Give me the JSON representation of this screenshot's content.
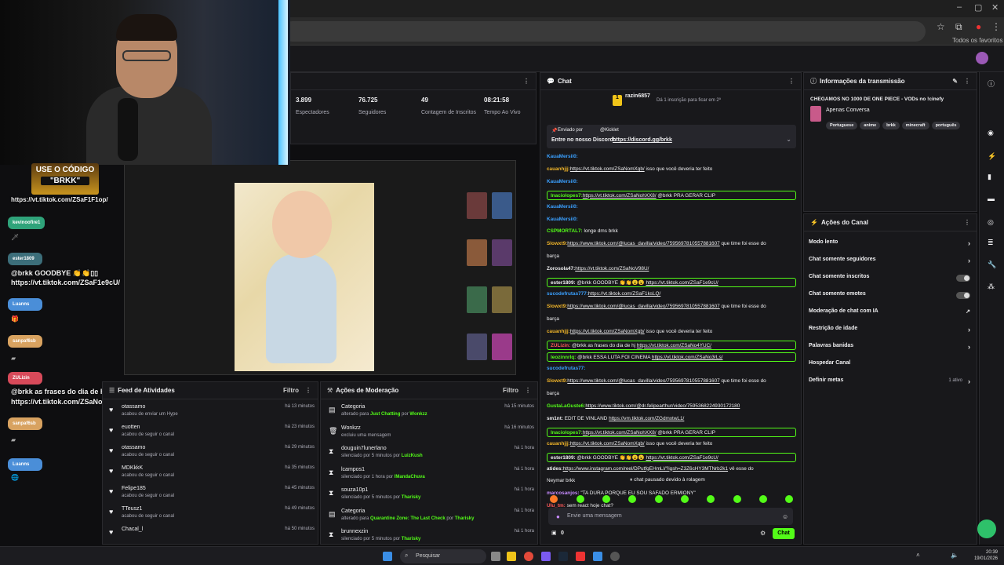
{
  "browser": {
    "favorites_label": "Todos os favoritos"
  },
  "stats": [
    {
      "value": "3.899",
      "label": "Espectadores"
    },
    {
      "value": "76.725",
      "label": "Seguidores"
    },
    {
      "value": "49",
      "label": "Contagem de Inscritos"
    },
    {
      "value": "08:21:58",
      "label": "Tempo Ao Vivo"
    }
  ],
  "overlay": {
    "code_banner_l1": "USE O CÓDIGO",
    "code_banner_l2": "\"BRKK\"",
    "line1": "https://vt.tiktok.com/ZSaF1F1op/",
    "tag1": "kevinoofire1",
    "tag2": "ester1809",
    "msg2a": "@brkk GOODBYE 👏👏▯▯",
    "msg2b": "https://vt.tiktok.com/ZSaF1e9cU/",
    "tag3": "Luanns",
    "tag4": "sanpaf6sb",
    "tag5": "ZULizin",
    "msg5a": "@brkk as frases do dia de hj",
    "msg5b": "https://vt.tiktok.com/ZSaNo4YUC/",
    "tag6": "sanpaf6sb",
    "tag7": "Luanns"
  },
  "feed": {
    "title": "Feed de Atividades",
    "filter": "Filtro",
    "items": [
      {
        "name": "otassamo",
        "sub": "acabou de enviar um Hype",
        "time": "há 13 minutos"
      },
      {
        "name": "euotten",
        "sub": "acabou de seguir o canal",
        "time": "há 23 minutos"
      },
      {
        "name": "otassamo",
        "sub": "acabou de seguir o canal",
        "time": "há 29 minutos"
      },
      {
        "name": "MDKkkK",
        "sub": "acabou de seguir o canal",
        "time": "há 35 minutos"
      },
      {
        "name": "Felipe185",
        "sub": "acabou de seguir o canal",
        "time": "há 45 minutos"
      },
      {
        "name": "TTeusz1",
        "sub": "acabou de seguir o canal",
        "time": "há 49 minutos"
      },
      {
        "name": "Chacal_l",
        "sub": "",
        "time": "há 50 minutos"
      }
    ]
  },
  "mod": {
    "title": "Ações de Moderação",
    "filter": "Filtro",
    "items": [
      {
        "name": "Categoria",
        "pre": "alterado para",
        "hl": "Just Chatting",
        "mid": "por",
        "by": "Wonkzz",
        "time": "há 15 minutos",
        "icon": "▤"
      },
      {
        "name": "Wonkzz",
        "pre": "excluiu uma mensagem",
        "hl": "",
        "mid": "",
        "by": "",
        "time": "há 16 minutos",
        "icon": "🗑"
      },
      {
        "name": "douguin7lunerlano",
        "pre": "silenciado por 5 minutos por",
        "hl": "",
        "mid": "",
        "by": "LuizKush",
        "time": "há 1 hora",
        "icon": "⧗"
      },
      {
        "name": "lcampos1",
        "pre": "silenciado por 1 hora por",
        "hl": "",
        "mid": "",
        "by": "lMandaChuva",
        "time": "há 1 hora",
        "icon": "⧗"
      },
      {
        "name": "souza10p1",
        "pre": "silenciado por 5 minutos por",
        "hl": "",
        "mid": "",
        "by": "Tharisky",
        "time": "há 1 hora",
        "icon": "⧗"
      },
      {
        "name": "Categoria",
        "pre": "alterado para",
        "hl": "Quarantine Zone: The Last Check",
        "mid": "por",
        "by": "Tharisky",
        "time": "há 1 hora",
        "icon": "▤"
      },
      {
        "name": "brunnexzin",
        "pre": "silenciado por 5 minutos por",
        "hl": "",
        "mid": "",
        "by": "Tharisky",
        "time": "há 1 hora",
        "icon": "⧗"
      }
    ]
  },
  "chat": {
    "title": "Chat",
    "top_user": "razin6857",
    "top_info": "Dá 1 inscrição para ficar em 2º",
    "pinned_by": "Enviado por",
    "pinned_user": "@Kicklet",
    "pinned_text": "Entre no nosso Discord:",
    "pinned_link": "https://discord.gg/brkk",
    "messages": [
      {
        "user": "KauaMersii0:",
        "color": "#3aa0ff",
        "text": "",
        "link": "",
        "hl": false
      },
      {
        "user": "cauanhjjj:",
        "color": "#f0b429",
        "text": "",
        "link": "https://vt.tiktok.com/ZSaNomXgb/",
        "after": " isso que você deveria ter feito",
        "hl": false
      },
      {
        "user": "KauaMersii0:",
        "color": "#3aa0ff",
        "text": "",
        "link": "",
        "hl": false
      },
      {
        "user": "Inaciolopes7:",
        "color": "#53fc18",
        "text": "",
        "link": "https://vt.tiktok.com/ZSaNohXX8/",
        "after": " @brkk PRA GERAR CLIP",
        "hl": true
      },
      {
        "user": "KauaMersii0:",
        "color": "#3aa0ff",
        "text": "",
        "link": "",
        "hl": false
      },
      {
        "user": "KauaMersii0:",
        "color": "#3aa0ff",
        "text": "",
        "link": "",
        "hl": false
      },
      {
        "user": "CSPMORTAL7:",
        "color": "#53fc18",
        "text": " longe dms brkk",
        "link": "",
        "hl": false
      },
      {
        "user": "Slowxt9:",
        "color": "#f0b429",
        "text": "",
        "link": "https://www.tiktok.com/@lucas_davilla/video/7595697810557881607",
        "after": " que time foi esse do",
        "hl": false
      },
      {
        "user": "",
        "color": "#efeff1",
        "text": "barça",
        "link": "",
        "hl": false
      },
      {
        "user": "Zorosola47:",
        "color": "#efeff1",
        "text": "",
        "link": "https://vt.tiktok.com/ZSaNoV98U/",
        "hl": false
      },
      {
        "user": "ester1809:",
        "color": "#efeff1",
        "text": " @brkk GOODBYE 👏👏😮😮 ",
        "link": "https://vt.tiktok.com/ZSaF1e9cU/",
        "hl": true
      },
      {
        "user": "sucodefrutas777:",
        "color": "#3aa0ff",
        "text": "",
        "link": "https://vt.tiktok.com/ZSaF1ksLQ/",
        "hl": false
      },
      {
        "user": "Slowxt9:",
        "color": "#f0b429",
        "text": "",
        "link": "https://www.tiktok.com/@lucas_davilla/video/7595697810557881607",
        "after": " que time foi esse do",
        "hl": false
      },
      {
        "user": "",
        "color": "#efeff1",
        "text": "barça",
        "link": "",
        "hl": false
      },
      {
        "user": "cauanhjjj:",
        "color": "#f0b429",
        "text": "",
        "link": "https://vt.tiktok.com/ZSaNomXgb/",
        "after": " isso que você deveria ter feito",
        "hl": false
      },
      {
        "user": "ZULizin:",
        "color": "#ff5a5a",
        "text": " @brkk as frases do dia de hj ",
        "link": "https://vt.tiktok.com/ZSaNo4YUC/",
        "hl": true
      },
      {
        "user": "leozinnrlq:",
        "color": "#53fc18",
        "text": " @brkk ESSA LUTA FOI CINEMA ",
        "link": "https://vt.tiktok.com/ZSaNo3rLs/",
        "hl": true
      },
      {
        "user": "sucodefrutas77:",
        "color": "#3aa0ff",
        "text": "",
        "link": "",
        "hl": false
      },
      {
        "user": "Slowxt9:",
        "color": "#f0b429",
        "text": "",
        "link": "https://www.tiktok.com/@lucas_davilla/video/7595697810557881607",
        "after": " que time foi esse do",
        "hl": false
      },
      {
        "user": "",
        "color": "#efeff1",
        "text": "barça",
        "link": "",
        "hl": false
      },
      {
        "user": "GustaLaGuste6:",
        "color": "#53fc18",
        "text": "",
        "link": "https://www.tiktok.com/@dr.felipearthur/video/7595368224930172180",
        "hl": false
      },
      {
        "user": "sm1nt:",
        "color": "#efeff1",
        "text": " EDIT DE VINLAND ",
        "link": "https://vm.tiktok.com/ZGdmxtwL1/",
        "hl": false
      },
      {
        "user": "Inaciolopes7:",
        "color": "#53fc18",
        "text": "",
        "link": "https://vt.tiktok.com/ZSaNohXX8/",
        "after": " @brkk PRA GERAR CLIP",
        "hl": true
      },
      {
        "user": "cauanhjjj:",
        "color": "#f0b429",
        "text": "",
        "link": "https://vt.tiktok.com/ZSaNomXgb/",
        "after": " isso que você deveria ter feito",
        "hl": false
      },
      {
        "user": "ester1809:",
        "color": "#efeff1",
        "text": " @brkk GOODBYE 👏👏😮😮 ",
        "link": "https://vt.tiktok.com/ZSaF1e9cU/",
        "hl": true
      },
      {
        "user": "atides:",
        "color": "#efeff1",
        "text": "",
        "link": "https://www.instagram.com/reel/DPutfgEHmLl/?igsh=Z3Z6cHY3MTNrb2k1",
        "after": " vê esse do",
        "hl": false
      },
      {
        "user": "",
        "color": "#efeff1",
        "text": "Neymar brkk",
        "link": "",
        "hl": false
      },
      {
        "user": "marcosanjos:",
        "color": "#c78bff",
        "text": " \"TA DURA PORQUE EU SOU SAFADO ERMIONY\"",
        "link": "",
        "hl": false
      },
      {
        "user": "Ulu_tm:",
        "color": "#ff5a5a",
        "text": " sem react hoje chat?",
        "link": "",
        "hl": false
      }
    ],
    "paused": "chat pausado devido à rolagem",
    "input_placeholder": "Envie uma mensagem",
    "points": "0",
    "send": "Chat"
  },
  "info": {
    "title": "Informações da transmissão",
    "stream_title": "CHEGAMOS NO 1000 DE ONE PIECE - VODs no !cinefy",
    "category": "Apenas Conversa",
    "tags": [
      "Portuguese",
      "anime",
      "brkk",
      "minecraft",
      "português"
    ]
  },
  "actions": {
    "title": "Ações do Canal",
    "items": [
      {
        "label": "Modo lento",
        "kind": "chev"
      },
      {
        "label": "Chat somente seguidores",
        "kind": "chev"
      },
      {
        "label": "Chat somente inscritos",
        "kind": "toggle"
      },
      {
        "label": "Chat somente emotes",
        "kind": "toggle"
      },
      {
        "label": "Moderação de chat com IA",
        "kind": "ext"
      },
      {
        "label": "Restrição de idade",
        "kind": "chev"
      },
      {
        "label": "Palavras banidas",
        "kind": "chev"
      },
      {
        "label": "Hospedar Canal",
        "kind": "none"
      },
      {
        "label": "Definir metas",
        "kind": "chev",
        "badge": "1 ativo"
      }
    ]
  },
  "taskbar": {
    "search": "Pesquisar",
    "time": "20:39",
    "date": "19/01/2026"
  },
  "colors": {
    "accent": "#53fc18",
    "panel": "#18181b",
    "bg": "#0e0e10"
  }
}
